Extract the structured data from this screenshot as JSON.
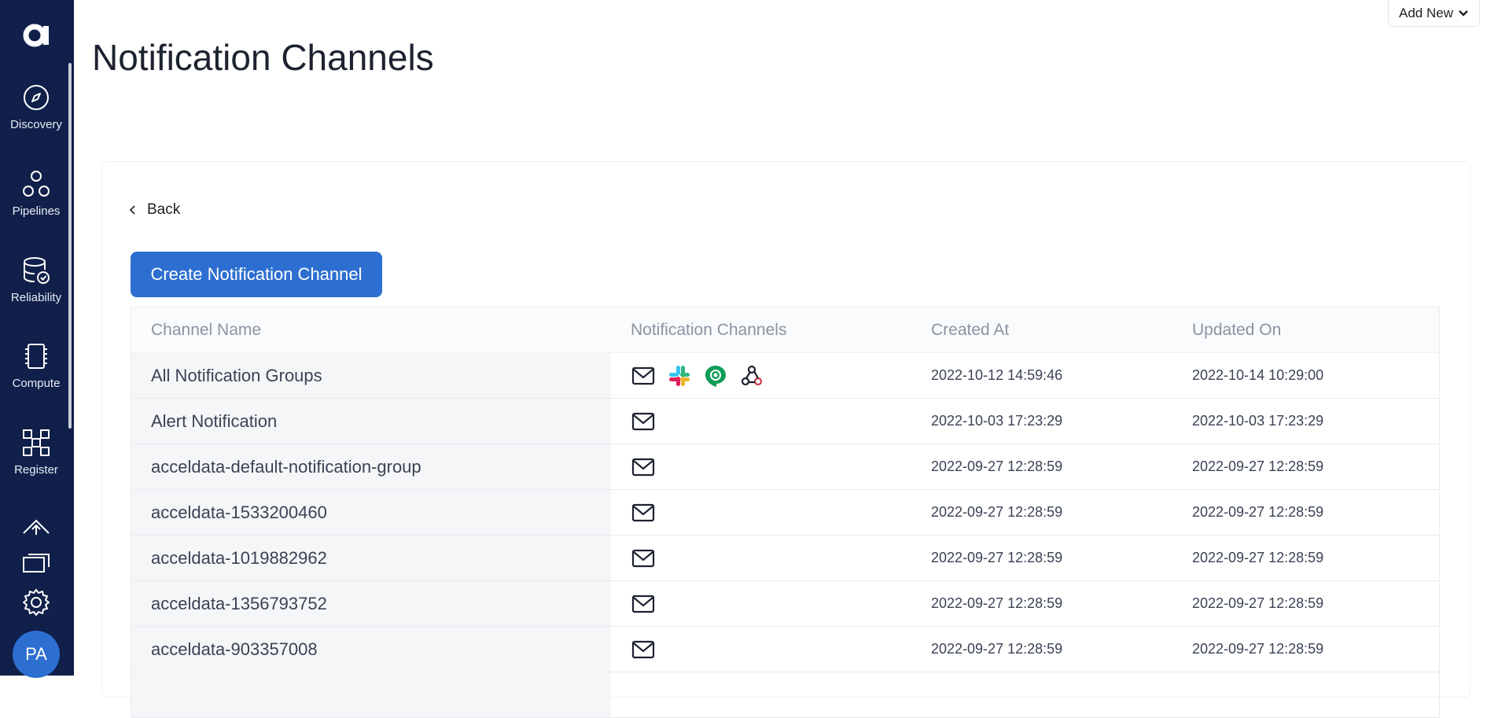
{
  "sidebar": {
    "logo": "a",
    "items": [
      {
        "label": "Discovery",
        "icon": "compass-icon"
      },
      {
        "label": "Pipelines",
        "icon": "pipelines-icon"
      },
      {
        "label": "Reliability",
        "icon": "database-check-icon"
      },
      {
        "label": "Compute",
        "icon": "chip-icon"
      },
      {
        "label": "Register",
        "icon": "register-icon"
      }
    ],
    "bottom_icons": [
      "upload-cloud-icon",
      "messages-icon",
      "gear-icon"
    ],
    "avatar_initials": "PA"
  },
  "header": {
    "add_new_label": "Add New",
    "title": "Notification Channels"
  },
  "back_label": "Back",
  "create_button_label": "Create Notification Channel",
  "table": {
    "columns": [
      "Channel Name",
      "Notification Channels",
      "Created At",
      "Updated On"
    ],
    "rows": [
      {
        "name": "All Notification Groups",
        "channels": [
          "email-icon",
          "slack-icon",
          "hangouts-icon",
          "webhook-icon"
        ],
        "created": "2022-10-12 14:59:46",
        "updated": "2022-10-14 10:29:00"
      },
      {
        "name": "Alert Notification",
        "channels": [
          "email-icon"
        ],
        "created": "2022-10-03 17:23:29",
        "updated": "2022-10-03 17:23:29"
      },
      {
        "name": "acceldata-default-notification-group",
        "channels": [
          "email-icon"
        ],
        "created": "2022-09-27 12:28:59",
        "updated": "2022-09-27 12:28:59"
      },
      {
        "name": "acceldata-1533200460",
        "channels": [
          "email-icon"
        ],
        "created": "2022-09-27 12:28:59",
        "updated": "2022-09-27 12:28:59"
      },
      {
        "name": "acceldata-1019882962",
        "channels": [
          "email-icon"
        ],
        "created": "2022-09-27 12:28:59",
        "updated": "2022-09-27 12:28:59"
      },
      {
        "name": "acceldata-1356793752",
        "channels": [
          "email-icon"
        ],
        "created": "2022-09-27 12:28:59",
        "updated": "2022-09-27 12:28:59"
      },
      {
        "name": "acceldata-903357008",
        "channels": [
          "email-icon"
        ],
        "created": "2022-09-27 12:28:59",
        "updated": "2022-09-27 12:28:59"
      },
      {
        "name": "",
        "channels": [],
        "created": "",
        "updated": ""
      }
    ]
  },
  "colors": {
    "sidebar_bg": "#10204a",
    "primary": "#2d6fd1",
    "slack": [
      "#36c5f0",
      "#2eb67d",
      "#ecb22e",
      "#e01e5a"
    ],
    "hangouts": "#0f9d58"
  }
}
